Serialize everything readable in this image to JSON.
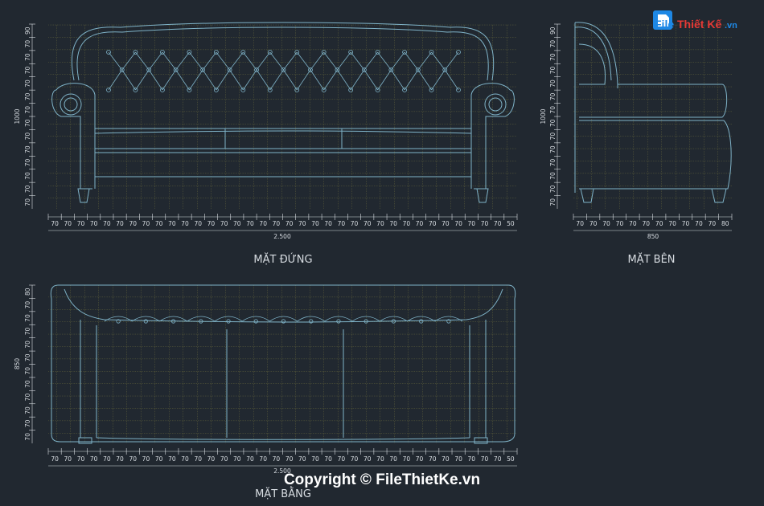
{
  "views": {
    "front": {
      "title": "MẶT ĐỨNG",
      "width_label": "2.500",
      "height_label": "1000",
      "h_ticks": [
        "70",
        "70",
        "70",
        "70",
        "70",
        "70",
        "70",
        "70",
        "70",
        "70",
        "70",
        "70",
        "70",
        "70",
        "70",
        "70",
        "70",
        "70",
        "70",
        "70",
        "70",
        "70",
        "70",
        "70",
        "70",
        "70",
        "70",
        "70",
        "70",
        "70",
        "70",
        "70",
        "70",
        "70",
        "70",
        "50"
      ],
      "v_ticks": [
        "90",
        "70",
        "70",
        "70",
        "70",
        "70",
        "70",
        "70",
        "70",
        "70",
        "70",
        "70",
        "70",
        "70"
      ]
    },
    "side": {
      "title": "MẶT BÊN",
      "width_label": "850",
      "height_label": "1000",
      "h_ticks": [
        "70",
        "70",
        "70",
        "70",
        "70",
        "70",
        "70",
        "70",
        "70",
        "70",
        "70",
        "80"
      ],
      "v_ticks": [
        "90",
        "70",
        "70",
        "70",
        "70",
        "70",
        "70",
        "70",
        "70",
        "70",
        "70",
        "70",
        "70",
        "70"
      ]
    },
    "plan": {
      "title": "MẶT BẰNG",
      "width_label": "2.500",
      "height_label": "850",
      "h_ticks": [
        "70",
        "70",
        "70",
        "70",
        "70",
        "70",
        "70",
        "70",
        "70",
        "70",
        "70",
        "70",
        "70",
        "70",
        "70",
        "70",
        "70",
        "70",
        "70",
        "70",
        "70",
        "70",
        "70",
        "70",
        "70",
        "70",
        "70",
        "70",
        "70",
        "70",
        "70",
        "70",
        "70",
        "70",
        "70",
        "50"
      ],
      "v_ticks": [
        "80",
        "70",
        "70",
        "70",
        "70",
        "70",
        "70",
        "70",
        "70",
        "70",
        "70",
        "70"
      ]
    }
  },
  "watermark": {
    "text": "Copyright © FileThietKe.vn"
  },
  "logo": {
    "part1": "File",
    "part2": "Thiết Kế",
    "part3": ".vn"
  },
  "colors": {
    "background": "#212830",
    "grid": "#c8c04a",
    "outline": "#7fb3c8",
    "dimension": "#d8dde2"
  }
}
